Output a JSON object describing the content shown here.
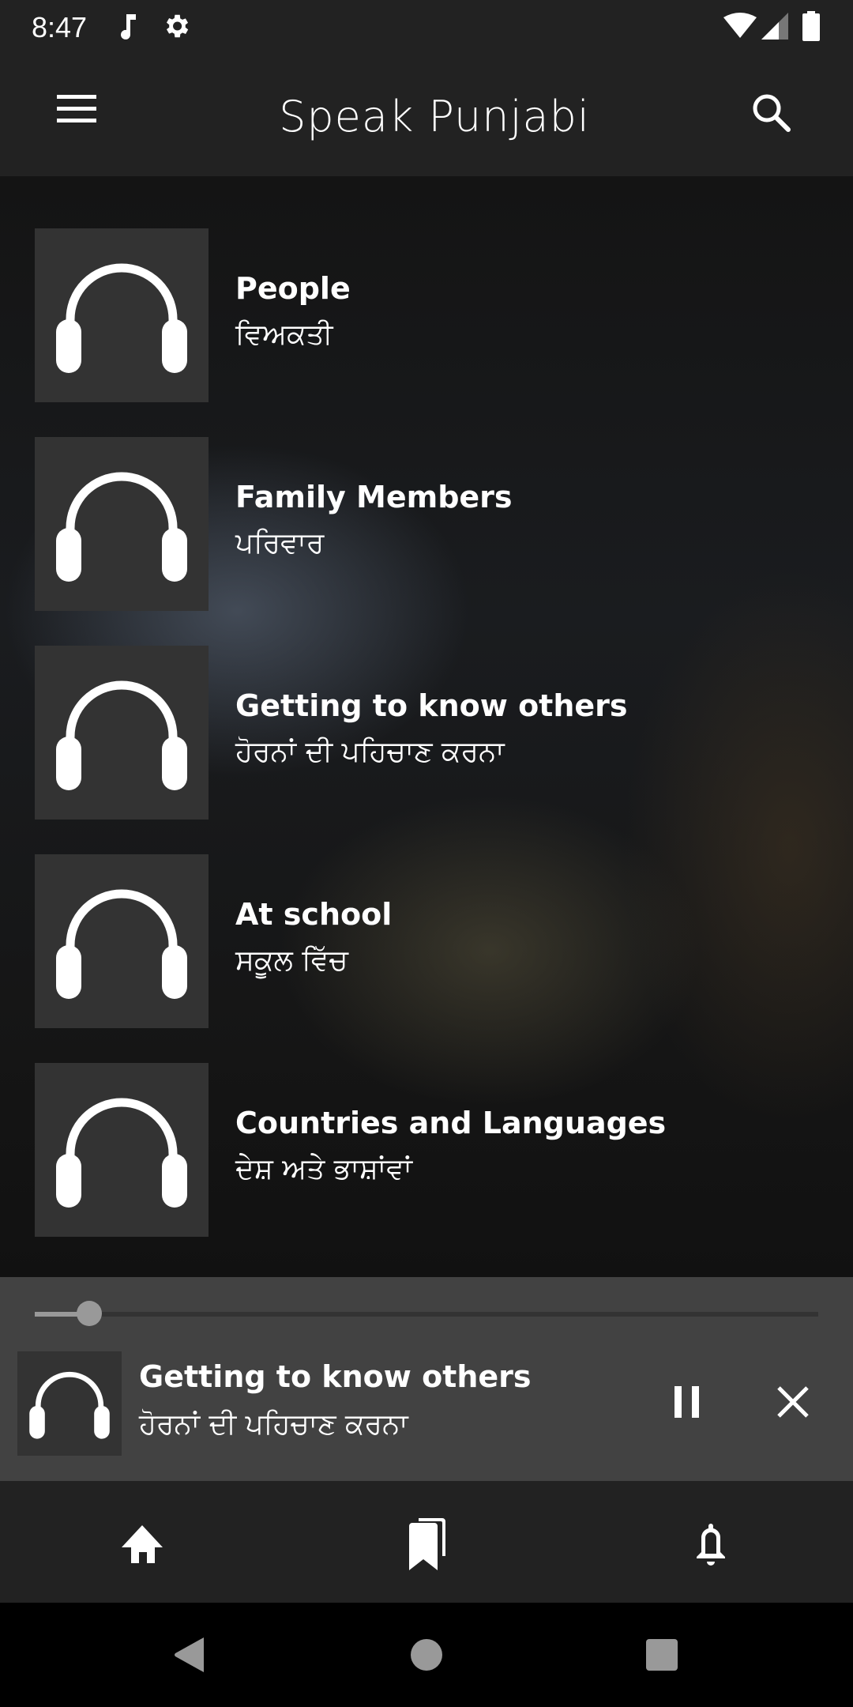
{
  "status_bar": {
    "time": "8:47",
    "left_icons": [
      "music-note-icon",
      "settings-gear-icon"
    ],
    "right_icons": [
      "wifi-icon",
      "signal-icon",
      "battery-icon"
    ]
  },
  "app_bar": {
    "title": "Speak Punjabi",
    "menu_icon": "hamburger-menu-icon",
    "search_icon": "search-icon"
  },
  "lessons": [
    {
      "title": "People",
      "subtitle": "ਵਿਅਕਤੀ",
      "icon": "headphones-icon"
    },
    {
      "title": "Family Members",
      "subtitle": "ਪਰਿਵਾਰ",
      "icon": "headphones-icon"
    },
    {
      "title": "Getting to know others",
      "subtitle": "ਹੋਰਨਾਂ ਦੀ ਪਹਿਚਾਣ ਕਰਨਾ",
      "icon": "headphones-icon"
    },
    {
      "title": "At school",
      "subtitle": "ਸਕੂਲ ਵਿੱਚ",
      "icon": "headphones-icon"
    },
    {
      "title": "Countries and Languages",
      "subtitle": "ਦੇਸ਼ ਅਤੇ ਭਾਸ਼ਾਂਵਾਂ",
      "icon": "headphones-icon"
    }
  ],
  "player": {
    "title": "Getting to know others",
    "subtitle": "ਹੋਰਨਾਂ ਦੀ ਪਹਿਚਾਣ ਕਰਨਾ",
    "progress_fraction": 0.07,
    "state": "playing",
    "pause_icon": "pause-icon",
    "close_icon": "close-icon"
  },
  "bottom_nav": {
    "items": [
      {
        "name": "home",
        "icon": "home-icon"
      },
      {
        "name": "bookmarks",
        "icon": "bookmarks-icon"
      },
      {
        "name": "notifications",
        "icon": "bell-icon"
      }
    ]
  },
  "system_nav": {
    "items": [
      "back-icon",
      "home-circle-icon",
      "recents-icon"
    ]
  },
  "colors": {
    "app_bar_bg": "#222222",
    "player_bg": "#424242",
    "thumb_bg": "#333333",
    "seek_color": "#999999"
  }
}
